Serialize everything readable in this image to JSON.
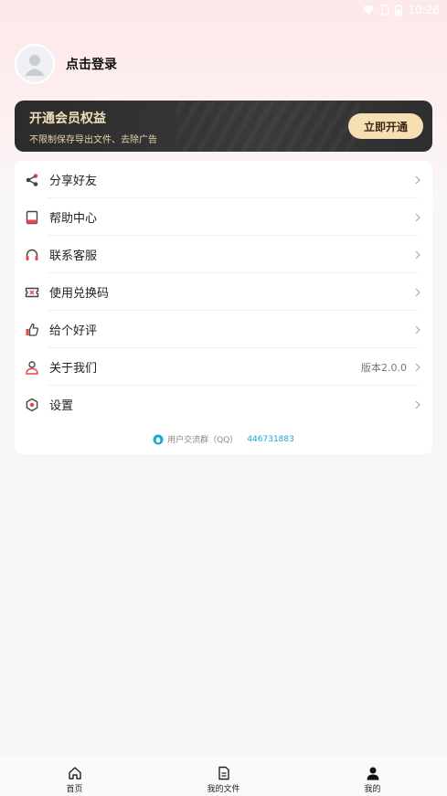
{
  "status_bar": {
    "time": "10:26"
  },
  "profile": {
    "login_label": "点击登录"
  },
  "vip": {
    "title": "开通会员权益",
    "subtitle": "不限制保存导出文件、去除广告",
    "button_label": "立即开通"
  },
  "menu": {
    "items": [
      {
        "label": "分享好友",
        "icon": "share-icon"
      },
      {
        "label": "帮助中心",
        "icon": "book-icon"
      },
      {
        "label": "联系客服",
        "icon": "headset-icon"
      },
      {
        "label": "使用兑换码",
        "icon": "ticket-icon"
      },
      {
        "label": "给个好评",
        "icon": "thumbs-up-icon"
      },
      {
        "label": "关于我们",
        "icon": "person-icon",
        "extra": "版本2.0.0"
      },
      {
        "label": "设置",
        "icon": "gear-icon"
      }
    ]
  },
  "qq_group": {
    "label": "用户交流群（QQ）",
    "number": "446731883"
  },
  "tabbar": {
    "tabs": [
      {
        "label": "首页",
        "icon": "home-icon"
      },
      {
        "label": "我的文件",
        "icon": "file-icon"
      },
      {
        "label": "我的",
        "icon": "user-icon"
      }
    ]
  },
  "colors": {
    "accent_red": "#e8474f",
    "vip_gold": "#f6dfb3",
    "link_blue": "#1ba6d6"
  }
}
